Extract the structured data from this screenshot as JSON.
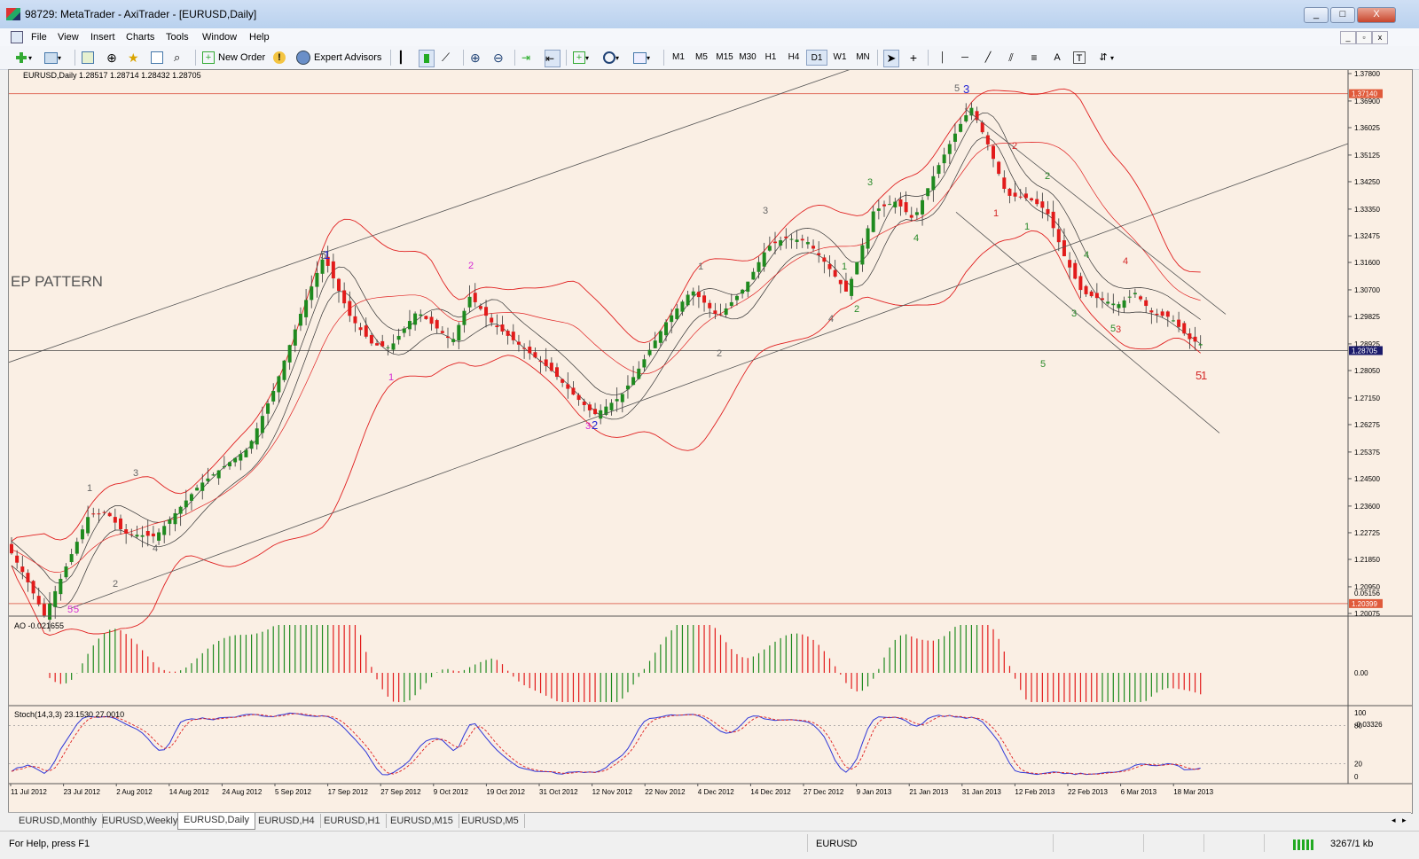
{
  "window": {
    "title": "98729: MetaTrader - AxiTrader - [EURUSD,Daily]",
    "min": "_",
    "max": "□",
    "close": "X"
  },
  "menu": [
    "File",
    "View",
    "Insert",
    "Charts",
    "Tools",
    "Window",
    "Help"
  ],
  "toolbar": {
    "new_order": "New Order",
    "expert_advisors": "Expert Advisors",
    "timeframes": [
      "M1",
      "M5",
      "M15",
      "M30",
      "H1",
      "H4",
      "D1",
      "W1",
      "MN"
    ],
    "active_timeframe": "D1"
  },
  "chart": {
    "header": "EURUSD,Daily  1.28517 1.28714 1.28432 1.28705",
    "overlay_text": "EP PATTERN",
    "price_labels": [
      "1.37800",
      "1.37140",
      "1.36900",
      "1.36025",
      "1.35125",
      "1.34250",
      "1.33350",
      "1.32475",
      "1.31600",
      "1.30700",
      "1.29825",
      "1.28925",
      "1.28705",
      "1.28050",
      "1.27150",
      "1.26275",
      "1.25375",
      "1.24500",
      "1.23600",
      "1.22725",
      "1.21850",
      "1.20950",
      "1.20399",
      "1.20075"
    ],
    "highlight_labels": {
      "top_line": "1.37140",
      "current": "1.28705",
      "bottom_line": "1.20399"
    },
    "date_labels": [
      "11 Jul 2012",
      "23 Jul 2012",
      "2 Aug 2012",
      "14 Aug 2012",
      "24 Aug 2012",
      "5 Sep 2012",
      "17 Sep 2012",
      "27 Sep 2012",
      "9 Oct 2012",
      "19 Oct 2012",
      "31 Oct 2012",
      "12 Nov 2012",
      "22 Nov 2012",
      "4 Dec 2012",
      "14 Dec 2012",
      "27 Dec 2012",
      "9 Jan 2013",
      "21 Jan 2013",
      "31 Jan 2013",
      "12 Feb 2013",
      "22 Feb 2013",
      "6 Mar 2013",
      "18 Mar 2013"
    ],
    "wave_labels": [
      {
        "t": "5",
        "c": "#d428d4"
      },
      {
        "t": "5",
        "c": "#d428d4"
      },
      {
        "t": "1",
        "c": "#666666"
      },
      {
        "t": "2",
        "c": "#666666"
      },
      {
        "t": "3",
        "c": "#666666"
      },
      {
        "t": "4",
        "c": "#666666"
      },
      {
        "t": "5",
        "c": "#666666"
      },
      {
        "t": "1",
        "c": "#2828d4"
      },
      {
        "t": "1",
        "c": "#d428d4"
      },
      {
        "t": "2",
        "c": "#d428d4"
      },
      {
        "t": "3",
        "c": "#d428d4"
      },
      {
        "t": "2",
        "c": "#2828d4"
      },
      {
        "t": "1",
        "c": "#666666"
      },
      {
        "t": "2",
        "c": "#666666"
      },
      {
        "t": "3",
        "c": "#666666"
      },
      {
        "t": "4",
        "c": "#666666"
      },
      {
        "t": "1",
        "c": "#2a8a2a"
      },
      {
        "t": "2",
        "c": "#2a8a2a"
      },
      {
        "t": "3",
        "c": "#2a8a2a"
      },
      {
        "t": "4",
        "c": "#2a8a2a"
      },
      {
        "t": "5",
        "c": "#2a8a2a"
      },
      {
        "t": "5",
        "c": "#666666"
      },
      {
        "t": "3",
        "c": "#2828d4"
      },
      {
        "t": "1",
        "c": "#d42828"
      },
      {
        "t": "2",
        "c": "#d42828"
      },
      {
        "t": "1",
        "c": "#2a8a2a"
      },
      {
        "t": "2",
        "c": "#2a8a2a"
      },
      {
        "t": "3",
        "c": "#2a8a2a"
      },
      {
        "t": "4",
        "c": "#2a8a2a"
      },
      {
        "t": "5",
        "c": "#2a8a2a"
      },
      {
        "t": "3",
        "c": "#d42828"
      },
      {
        "t": "4",
        "c": "#d42828"
      },
      {
        "t": "5",
        "c": "#d42828"
      },
      {
        "t": "1",
        "c": "#d42828"
      }
    ]
  },
  "ao": {
    "header": "AO -0.021655",
    "labels": [
      "0.05156",
      "0.00",
      "-0.03326"
    ]
  },
  "stoch": {
    "header": "Stoch(14,3,3) 23.1530 27.0010",
    "labels": [
      "100",
      "80",
      "20",
      "0"
    ]
  },
  "tabs": [
    "EURUSD,Monthly",
    "EURUSD,Weekly",
    "EURUSD,Daily",
    "EURUSD,H4",
    "EURUSD,H1",
    "EURUSD,M15",
    "EURUSD,M5"
  ],
  "active_tab": "EURUSD,Daily",
  "status": {
    "help": "For Help, press F1",
    "symbol": "EURUSD",
    "traffic": "3267/1 kb"
  },
  "colors": {
    "bull": "#1f8a1f",
    "bear": "#e21b1b",
    "chart_bg": "#faefe4",
    "bollinger": "#e02020",
    "envelope": "#333333"
  }
}
